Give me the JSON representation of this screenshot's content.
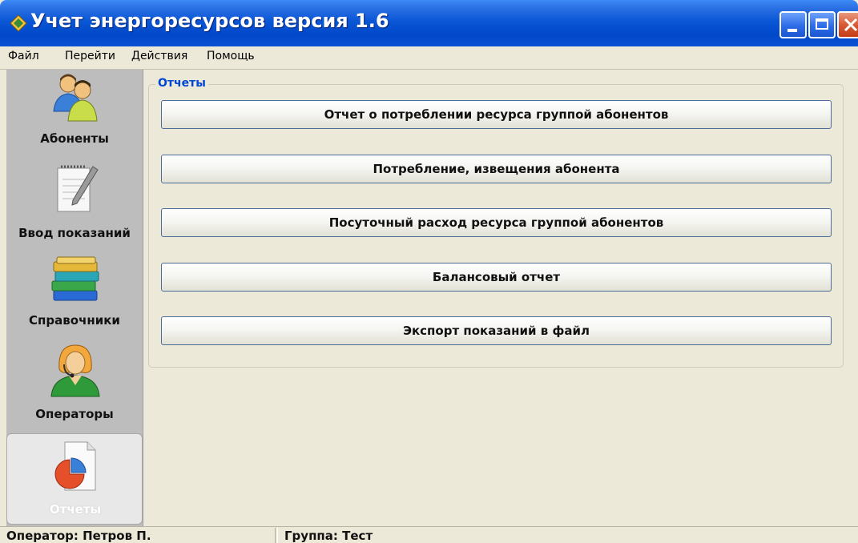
{
  "window": {
    "title": "Учет энергоресурсов версия 1.6",
    "minimize_label": "_",
    "maximize_label": "□",
    "close_label": "X",
    "titlebar_color": "#0a57d6",
    "close_color": "#d85a35"
  },
  "menu": {
    "items": [
      {
        "label": "Файл"
      },
      {
        "label": "Перейти"
      },
      {
        "label": "Действия"
      },
      {
        "label": "Помощь"
      }
    ]
  },
  "sidebar": {
    "items": [
      {
        "label": "Абоненты",
        "icon": "users-icon"
      },
      {
        "label": "Ввод показаний",
        "icon": "notepad-pencil-icon"
      },
      {
        "label": "Справочники",
        "icon": "books-icon"
      },
      {
        "label": "Операторы",
        "icon": "operator-headset-icon"
      },
      {
        "label": "Отчеты",
        "icon": "report-chart-icon",
        "active": true
      }
    ]
  },
  "reports": {
    "group_title": "Отчеты",
    "buttons": [
      {
        "label": "Отчет о потреблении ресурса группой абонентов"
      },
      {
        "label": "Потребление, извещения абонента"
      },
      {
        "label": "Посуточный расход ресурса группой абонентов"
      },
      {
        "label": "Балансовый отчет"
      },
      {
        "label": "Экспорт показаний в файл"
      }
    ],
    "accent_color": "#0046d5"
  },
  "status": {
    "operator": "Оператор: Петров П.",
    "group": "Группа: Тест"
  }
}
